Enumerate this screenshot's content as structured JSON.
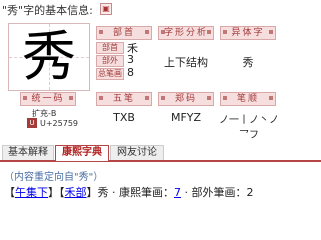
{
  "header": {
    "title": "\"秀\"字的基本信息:",
    "icon_glyph": "▣"
  },
  "character": {
    "glyph": "秀"
  },
  "radical_info": {
    "label": "部首",
    "rows": [
      {
        "key": "部首",
        "value": "禾"
      },
      {
        "key": "部外",
        "value": "3"
      },
      {
        "key": "总笔画",
        "value": "8"
      }
    ]
  },
  "structure": {
    "label": "字形分析",
    "value": "上下结构"
  },
  "variant": {
    "label": "异体字",
    "value": "秀"
  },
  "unicode": {
    "label": "统一码",
    "block": "扩充-B",
    "badge": "U",
    "code": "U+25759"
  },
  "wubi": {
    "label": "五笔",
    "value": "TXB"
  },
  "zhengma": {
    "label": "郑码",
    "value": "MFYZ"
  },
  "strokes": {
    "label": "笔顺",
    "value": "ノ一丨ノ丶ノ乛フ"
  },
  "tabs": [
    {
      "label": "基本解释",
      "active": false
    },
    {
      "label": "康熙字典",
      "active": true
    },
    {
      "label": "网友讨论",
      "active": false
    }
  ],
  "content": {
    "note": "（内容重定向自\"秀\"）",
    "line": {
      "open1": "【",
      "link1": "午集下",
      "close1": "】【",
      "link2": "禾部",
      "close2": "】",
      "rest1": "秀 · 康熙筆画：",
      "link3": "7",
      "rest2": " · 部外筆画：2"
    }
  },
  "colors": {
    "accent": "#b64545",
    "label_bg": "#f6dede",
    "link": "#0000ee"
  }
}
